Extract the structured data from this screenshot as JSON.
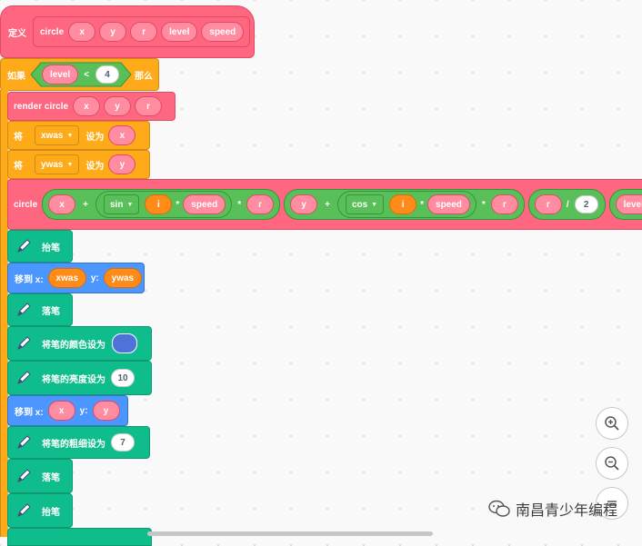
{
  "define": {
    "label": "定义",
    "name": "circle",
    "params": [
      "x",
      "y",
      "r",
      "level",
      "speed"
    ]
  },
  "if_block": {
    "label": "如果",
    "var": "level",
    "op": "<",
    "value": "4",
    "then": "那么"
  },
  "render": {
    "label": "render circle",
    "args": [
      "x",
      "y",
      "r"
    ]
  },
  "set1": {
    "label": "将",
    "var": "xwas",
    "to": "设为",
    "value": "x"
  },
  "set2": {
    "label": "将",
    "var": "ywas",
    "to": "设为",
    "value": "y"
  },
  "recurse": {
    "label": "circle",
    "x_expr": {
      "a": "x",
      "plus": "+",
      "fn": "sin",
      "i": "i",
      "mul1": "*",
      "speed": "speed",
      "mul2": "*",
      "r": "r"
    },
    "y_expr": {
      "a": "y",
      "plus": "+",
      "fn": "cos",
      "i": "i",
      "mul1": "*",
      "speed": "speed",
      "mul2": "*",
      "r": "r"
    },
    "r_expr": {
      "r": "r",
      "div": "/",
      "n": "2"
    },
    "level": "level"
  },
  "pen_up1": "抬笔",
  "goto1": {
    "label": "移到 x:",
    "x": "xwas",
    "ylabel": "y:",
    "y": "ywas"
  },
  "pen_down1": "落笔",
  "pen_color": {
    "label": "将笔的颜色设为",
    "color": "#4f72d8"
  },
  "pen_bright": {
    "label": "将笔的亮度设为",
    "value": "10"
  },
  "goto2": {
    "label": "移到 x:",
    "x": "x",
    "ylabel": "y:",
    "y": "y"
  },
  "pen_size": {
    "label": "将笔的粗细设为",
    "value": "7"
  },
  "pen_down2": "落笔",
  "pen_up2": "抬笔",
  "zoom": {
    "in": "zoom-in",
    "out": "zoom-out",
    "reset": "zoom-reset"
  },
  "watermark": "南昌青少年编程"
}
